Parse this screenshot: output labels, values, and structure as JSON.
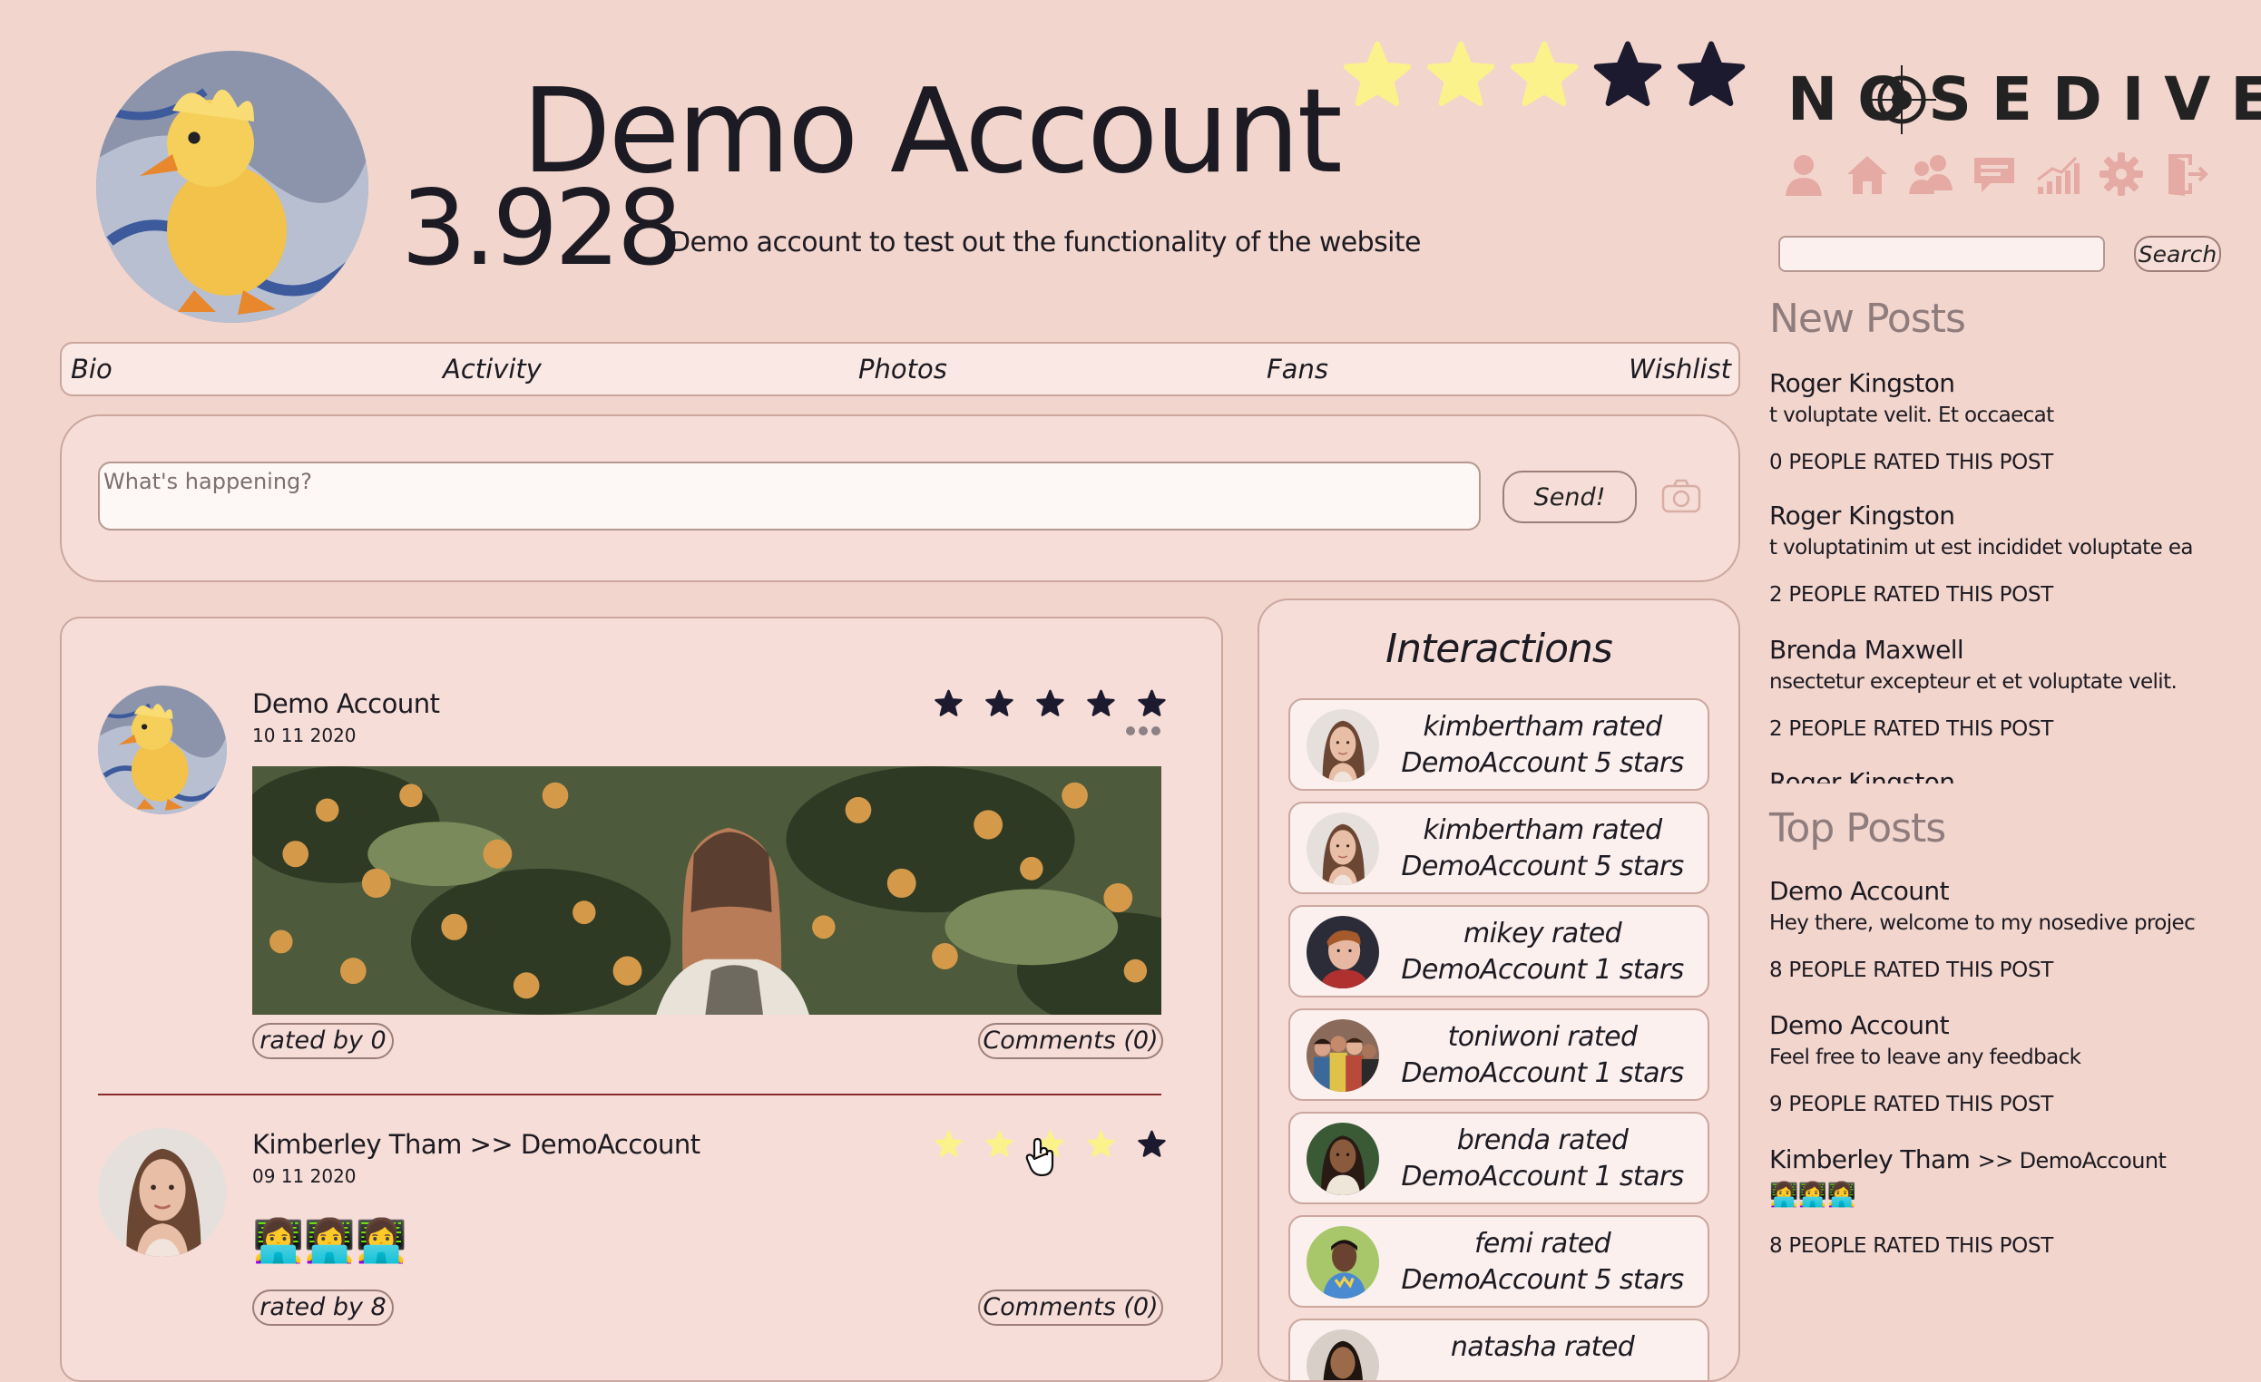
{
  "profile": {
    "name": "Demo Account",
    "score": "3.928",
    "bio": "Demo account to test out the functionality of the website",
    "stars_filled": 3,
    "stars_total": 5
  },
  "tabs": [
    "Bio",
    "Activity",
    "Photos",
    "Fans",
    "Wishlist"
  ],
  "composer": {
    "placeholder": "What's happening?",
    "send_label": "Send!"
  },
  "feed": [
    {
      "author": "Demo Account",
      "date": "10 11 2020",
      "rated_by": "rated by 0",
      "comments": "Comments (0)",
      "stars_highlighted": 0
    },
    {
      "author": "Kimberley Tham >> DemoAccount",
      "date": "09 11 2020",
      "content": "👩‍💻👩‍💻👩‍💻",
      "rated_by": "rated by 8",
      "comments": "Comments (0)",
      "stars_highlighted": 4
    }
  ],
  "interactions": {
    "title": "Interactions",
    "items": [
      "kimbertham rated DemoAccount 5 stars",
      "kimbertham rated DemoAccount 5 stars",
      "mikey rated DemoAccount 1 stars",
      "toniwoni rated DemoAccount 1 stars",
      "brenda rated DemoAccount 1 stars",
      "femi rated DemoAccount 5 stars",
      "natasha rated"
    ]
  },
  "sidebar": {
    "logo": "NOSEDIVE",
    "nav_icons": [
      "profile-icon",
      "home-icon",
      "friends-icon",
      "messages-icon",
      "stats-icon",
      "settings-icon",
      "logout-icon"
    ],
    "search_label": "Search",
    "new_posts_heading": "New Posts",
    "new_posts": [
      {
        "author": "Roger Kingston",
        "excerpt": "t voluptate velit. Et occaecat",
        "count": "0 PEOPLE RATED THIS POST"
      },
      {
        "author": "Roger Kingston",
        "excerpt": "t voluptatinim ut est incididet voluptate ea id amet.",
        "count": "2 PEOPLE RATED THIS POST"
      },
      {
        "author": "Brenda Maxwell",
        "excerpt": "nsectetur excepteur et et voluptate velit.",
        "count": "2 PEOPLE RATED THIS POST"
      },
      {
        "author": "Roger Kingston",
        "excerpt": "",
        "count": ""
      }
    ],
    "top_posts_heading": "Top Posts",
    "top_posts": [
      {
        "author": "Demo Account",
        "excerpt": "Hey there, welcome to my nosedive project!",
        "count": "8 PEOPLE RATED THIS POST"
      },
      {
        "author": "Demo Account",
        "excerpt": "Feel free to leave any feedback",
        "count": "9 PEOPLE RATED THIS POST"
      },
      {
        "author": "Kimberley Tham",
        "author_suffix": ">> DemoAccount",
        "excerpt": "👩‍💻👩‍💻👩‍💻",
        "count": "8 PEOPLE RATED THIS POST"
      }
    ]
  },
  "colors": {
    "background": "#f2d5cd",
    "panel": "#f6ddd7",
    "border": "#cba79e",
    "star_dark": "#1c1a2e",
    "star_yellow": "#fbf28c",
    "muted_heading": "#8f7c7d"
  }
}
